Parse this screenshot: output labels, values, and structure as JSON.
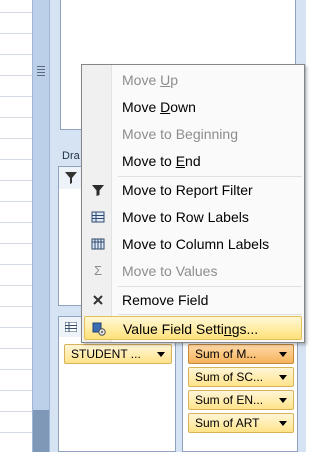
{
  "pane": {
    "drag_label": "Dra"
  },
  "context_menu": {
    "items": [
      {
        "pre": "Move ",
        "key": "U",
        "post": "p",
        "enabled": false,
        "icon": ""
      },
      {
        "pre": "Move ",
        "key": "D",
        "post": "own",
        "enabled": true,
        "icon": ""
      },
      {
        "pre": "Move to Be",
        "key": "g",
        "post": "inning",
        "enabled": false,
        "icon": ""
      },
      {
        "pre": "Move to ",
        "key": "E",
        "post": "nd",
        "enabled": true,
        "icon": ""
      },
      {
        "pre": "Move to Report Filter",
        "key": "",
        "post": "",
        "enabled": true,
        "icon": "filter-icon"
      },
      {
        "pre": "Move to Row Labels",
        "key": "",
        "post": "",
        "enabled": true,
        "icon": "row-labels-icon"
      },
      {
        "pre": "Move to Column Labels",
        "key": "",
        "post": "",
        "enabled": true,
        "icon": "column-labels-icon"
      },
      {
        "pre": "Move to Values",
        "key": "",
        "post": "",
        "enabled": false,
        "icon": "sigma-icon"
      },
      {
        "pre": "Remove Field",
        "key": "",
        "post": "",
        "enabled": true,
        "icon": "close-icon"
      },
      {
        "pre": "Value Field Setti",
        "key": "n",
        "post": "gs...",
        "enabled": true,
        "icon": "field-settings-icon"
      }
    ],
    "highlighted_index": 9
  },
  "row_labels": {
    "fields": [
      "STUDENT ..."
    ]
  },
  "values": {
    "fields": [
      "Sum of M...",
      "Sum of SC...",
      "Sum of EN...",
      "Sum of ART"
    ]
  },
  "colors": {
    "highlight": "#ffe17a",
    "pane_bg": "#d6e3f3",
    "chip_bg": "#ffe38a"
  }
}
